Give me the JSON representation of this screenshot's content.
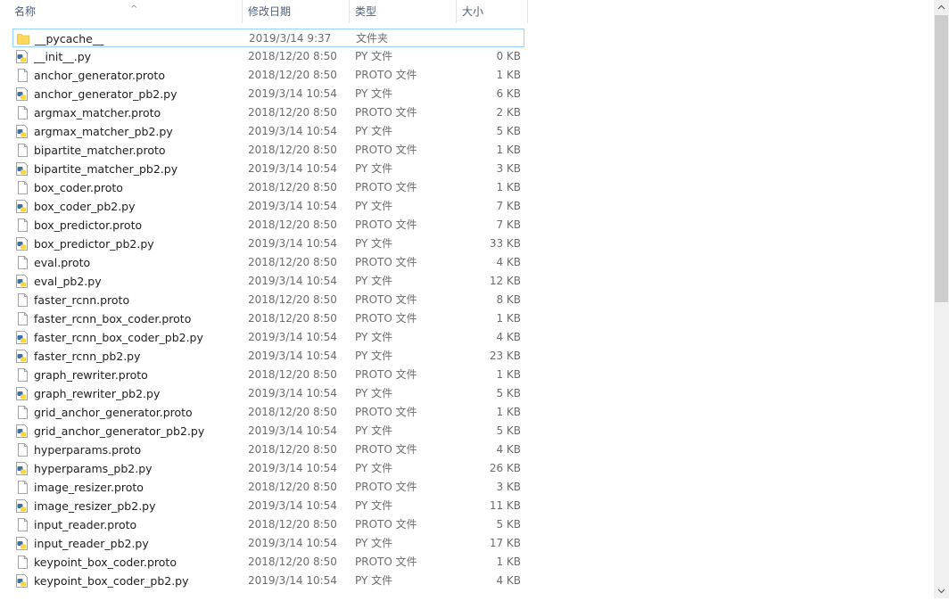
{
  "columns": {
    "name": "名称",
    "date": "修改日期",
    "type": "类型",
    "size": "大小"
  },
  "files": [
    {
      "name": "__pycache__",
      "date": "2019/3/14 9:37",
      "type": "文件夹",
      "size": "",
      "icon": "folder-icon"
    },
    {
      "name": "__init__.py",
      "date": "2018/12/20 8:50",
      "type": "PY 文件",
      "size": "0 KB",
      "icon": "python-file-icon"
    },
    {
      "name": "anchor_generator.proto",
      "date": "2018/12/20 8:50",
      "type": "PROTO 文件",
      "size": "1 KB",
      "icon": "file-icon"
    },
    {
      "name": "anchor_generator_pb2.py",
      "date": "2019/3/14 10:54",
      "type": "PY 文件",
      "size": "6 KB",
      "icon": "python-file-icon"
    },
    {
      "name": "argmax_matcher.proto",
      "date": "2018/12/20 8:50",
      "type": "PROTO 文件",
      "size": "2 KB",
      "icon": "file-icon"
    },
    {
      "name": "argmax_matcher_pb2.py",
      "date": "2019/3/14 10:54",
      "type": "PY 文件",
      "size": "5 KB",
      "icon": "python-file-icon"
    },
    {
      "name": "bipartite_matcher.proto",
      "date": "2018/12/20 8:50",
      "type": "PROTO 文件",
      "size": "1 KB",
      "icon": "file-icon"
    },
    {
      "name": "bipartite_matcher_pb2.py",
      "date": "2019/3/14 10:54",
      "type": "PY 文件",
      "size": "3 KB",
      "icon": "python-file-icon"
    },
    {
      "name": "box_coder.proto",
      "date": "2018/12/20 8:50",
      "type": "PROTO 文件",
      "size": "1 KB",
      "icon": "file-icon"
    },
    {
      "name": "box_coder_pb2.py",
      "date": "2019/3/14 10:54",
      "type": "PY 文件",
      "size": "7 KB",
      "icon": "python-file-icon"
    },
    {
      "name": "box_predictor.proto",
      "date": "2018/12/20 8:50",
      "type": "PROTO 文件",
      "size": "7 KB",
      "icon": "file-icon"
    },
    {
      "name": "box_predictor_pb2.py",
      "date": "2019/3/14 10:54",
      "type": "PY 文件",
      "size": "33 KB",
      "icon": "python-file-icon"
    },
    {
      "name": "eval.proto",
      "date": "2018/12/20 8:50",
      "type": "PROTO 文件",
      "size": "4 KB",
      "icon": "file-icon"
    },
    {
      "name": "eval_pb2.py",
      "date": "2019/3/14 10:54",
      "type": "PY 文件",
      "size": "12 KB",
      "icon": "python-file-icon"
    },
    {
      "name": "faster_rcnn.proto",
      "date": "2018/12/20 8:50",
      "type": "PROTO 文件",
      "size": "8 KB",
      "icon": "file-icon"
    },
    {
      "name": "faster_rcnn_box_coder.proto",
      "date": "2018/12/20 8:50",
      "type": "PROTO 文件",
      "size": "1 KB",
      "icon": "file-icon"
    },
    {
      "name": "faster_rcnn_box_coder_pb2.py",
      "date": "2019/3/14 10:54",
      "type": "PY 文件",
      "size": "4 KB",
      "icon": "python-file-icon"
    },
    {
      "name": "faster_rcnn_pb2.py",
      "date": "2019/3/14 10:54",
      "type": "PY 文件",
      "size": "23 KB",
      "icon": "python-file-icon"
    },
    {
      "name": "graph_rewriter.proto",
      "date": "2018/12/20 8:50",
      "type": "PROTO 文件",
      "size": "1 KB",
      "icon": "file-icon"
    },
    {
      "name": "graph_rewriter_pb2.py",
      "date": "2019/3/14 10:54",
      "type": "PY 文件",
      "size": "5 KB",
      "icon": "python-file-icon"
    },
    {
      "name": "grid_anchor_generator.proto",
      "date": "2018/12/20 8:50",
      "type": "PROTO 文件",
      "size": "1 KB",
      "icon": "file-icon"
    },
    {
      "name": "grid_anchor_generator_pb2.py",
      "date": "2019/3/14 10:54",
      "type": "PY 文件",
      "size": "5 KB",
      "icon": "python-file-icon"
    },
    {
      "name": "hyperparams.proto",
      "date": "2018/12/20 8:50",
      "type": "PROTO 文件",
      "size": "4 KB",
      "icon": "file-icon"
    },
    {
      "name": "hyperparams_pb2.py",
      "date": "2019/3/14 10:54",
      "type": "PY 文件",
      "size": "26 KB",
      "icon": "python-file-icon"
    },
    {
      "name": "image_resizer.proto",
      "date": "2018/12/20 8:50",
      "type": "PROTO 文件",
      "size": "3 KB",
      "icon": "file-icon"
    },
    {
      "name": "image_resizer_pb2.py",
      "date": "2019/3/14 10:54",
      "type": "PY 文件",
      "size": "11 KB",
      "icon": "python-file-icon"
    },
    {
      "name": "input_reader.proto",
      "date": "2018/12/20 8:50",
      "type": "PROTO 文件",
      "size": "5 KB",
      "icon": "file-icon"
    },
    {
      "name": "input_reader_pb2.py",
      "date": "2019/3/14 10:54",
      "type": "PY 文件",
      "size": "17 KB",
      "icon": "python-file-icon"
    },
    {
      "name": "keypoint_box_coder.proto",
      "date": "2018/12/20 8:50",
      "type": "PROTO 文件",
      "size": "1 KB",
      "icon": "file-icon"
    },
    {
      "name": "keypoint_box_coder_pb2.py",
      "date": "2019/3/14 10:54",
      "type": "PY 文件",
      "size": "4 KB",
      "icon": "python-file-icon"
    }
  ],
  "colors": {
    "folder": "#ffd75e",
    "folder_dark": "#e8b93c",
    "python_blue": "#3572a5",
    "python_yellow": "#ffd43b",
    "focus_border": "#99d1ff"
  }
}
